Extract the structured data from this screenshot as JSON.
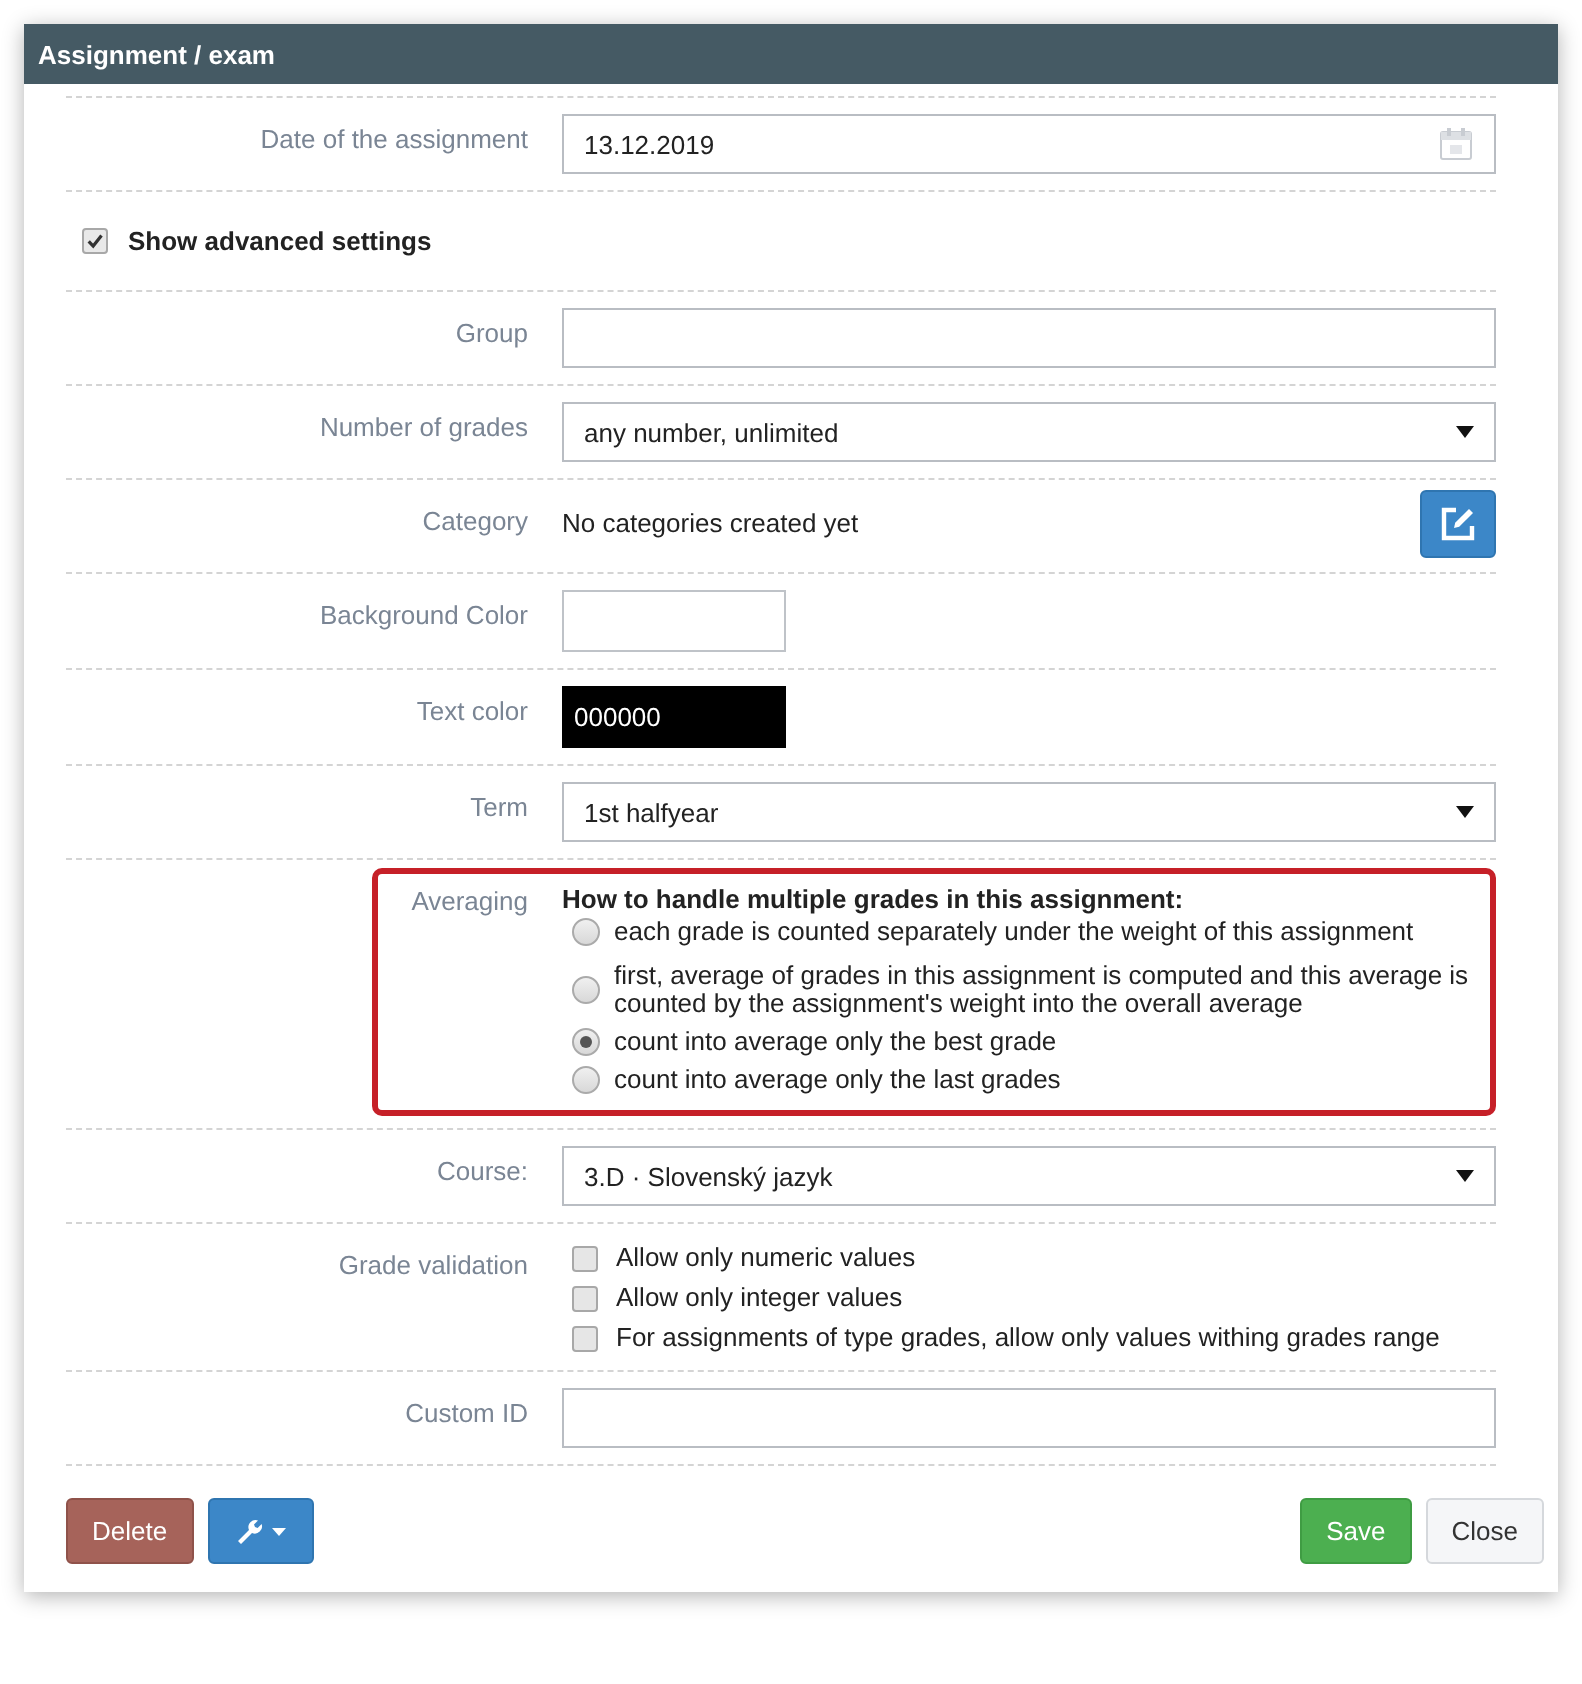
{
  "dialog": {
    "title": "Assignment / exam"
  },
  "rows": [
    {
      "kind": "date",
      "label": "Date of the assignment",
      "value": "13.12.2019"
    },
    {
      "kind": "toggle",
      "label": "Show advanced settings",
      "checked": true
    },
    {
      "kind": "text",
      "label": "Group"
    },
    {
      "kind": "select",
      "label": "Number of grades",
      "value": "any number, unlimited"
    },
    {
      "kind": "category",
      "label": "Category",
      "text": "No categories created yet"
    },
    {
      "kind": "color",
      "label": "Background Color"
    },
    {
      "kind": "color",
      "label": "Text color",
      "value": "000000",
      "color": "#000000"
    },
    {
      "kind": "select",
      "label": "Term",
      "value": "1st halfyear"
    },
    {
      "kind": "radios",
      "label": "Averaging",
      "heading": "How to handle multiple grades in this assignment:",
      "highlighted": true,
      "options": [
        {
          "label": "each grade is counted separately under the weight of this assignment",
          "selected": false
        },
        {
          "label": "first, average of grades in this assignment is computed and this average is counted by the assignment's weight into the overall average",
          "selected": false
        },
        {
          "label": "count into average only the best grade",
          "selected": true
        },
        {
          "label": "count into average only the last grades",
          "selected": false
        }
      ]
    },
    {
      "kind": "select",
      "label": "Course:",
      "value": "3.D · Slovenský jazyk"
    },
    {
      "kind": "checks",
      "label": "Grade validation",
      "options": [
        {
          "label": "Allow only numeric values",
          "checked": false
        },
        {
          "label": "Allow only integer values",
          "checked": false
        },
        {
          "label": "For assignments of type grades, allow only values withing grades range",
          "checked": false
        }
      ]
    },
    {
      "kind": "text",
      "label": "Custom ID"
    }
  ],
  "buttons": [
    {
      "kind": "delete",
      "label": "Delete"
    },
    {
      "kind": "tools"
    },
    {
      "kind": "save",
      "label": "Save"
    },
    {
      "kind": "close",
      "label": "Close"
    }
  ]
}
